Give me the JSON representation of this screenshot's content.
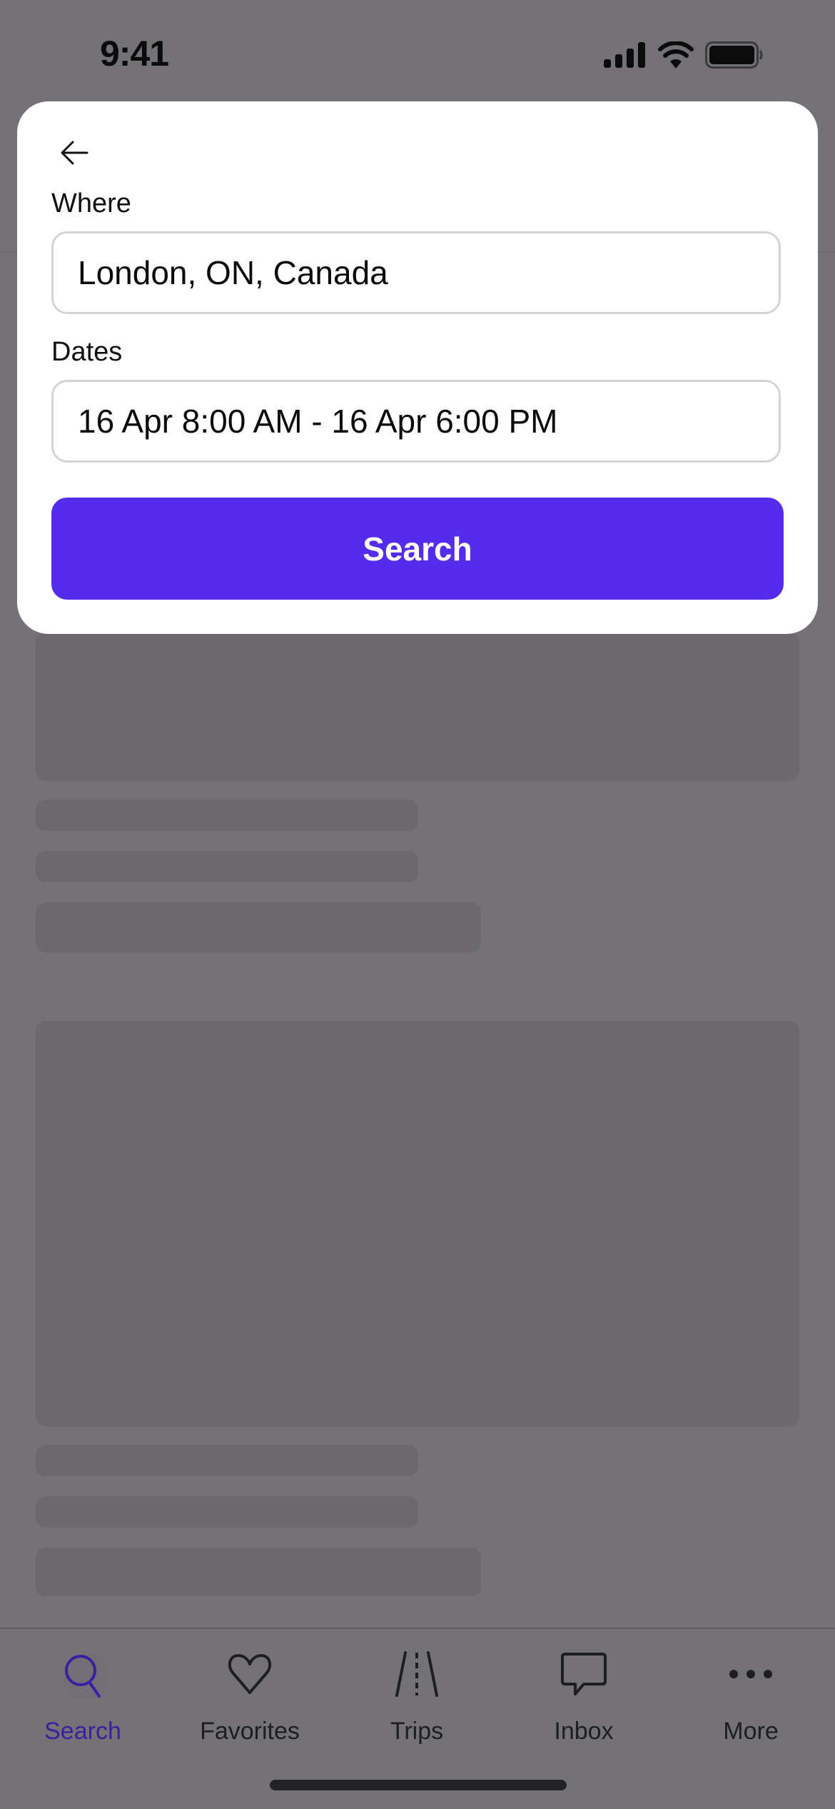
{
  "status_bar": {
    "time": "9:41",
    "icons": [
      "cellular-signal-icon",
      "wifi-icon",
      "battery-icon"
    ]
  },
  "search_modal": {
    "back_icon": "arrow-left-icon",
    "where_label": "Where",
    "where_value": "London, ON, Canada",
    "dates_label": "Dates",
    "dates_value": "16 Apr 8:00 AM - 16 Apr 6:00 PM",
    "search_button_label": "Search",
    "accent_color": "#552CED"
  },
  "tab_bar": {
    "active": "Search",
    "items": [
      {
        "label": "Search",
        "icon": "search-icon"
      },
      {
        "label": "Favorites",
        "icon": "heart-icon"
      },
      {
        "label": "Trips",
        "icon": "road-icon"
      },
      {
        "label": "Inbox",
        "icon": "chat-bubble-icon"
      },
      {
        "label": "More",
        "icon": "more-dots-icon"
      }
    ]
  }
}
